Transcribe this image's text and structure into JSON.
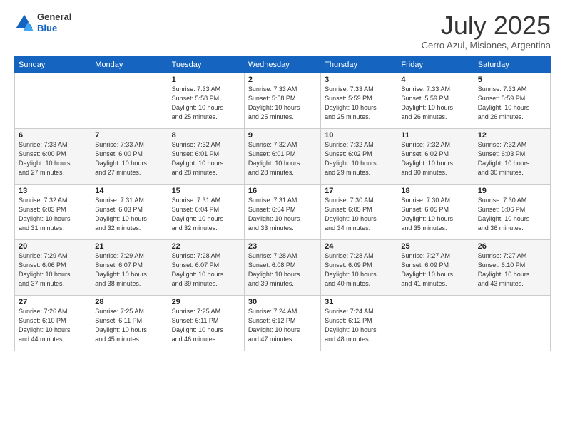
{
  "logo": {
    "general": "General",
    "blue": "Blue"
  },
  "header": {
    "title": "July 2025",
    "subtitle": "Cerro Azul, Misiones, Argentina"
  },
  "weekdays": [
    "Sunday",
    "Monday",
    "Tuesday",
    "Wednesday",
    "Thursday",
    "Friday",
    "Saturday"
  ],
  "weeks": [
    [
      {
        "day": "",
        "info": ""
      },
      {
        "day": "",
        "info": ""
      },
      {
        "day": "1",
        "info": "Sunrise: 7:33 AM\nSunset: 5:58 PM\nDaylight: 10 hours\nand 25 minutes."
      },
      {
        "day": "2",
        "info": "Sunrise: 7:33 AM\nSunset: 5:58 PM\nDaylight: 10 hours\nand 25 minutes."
      },
      {
        "day": "3",
        "info": "Sunrise: 7:33 AM\nSunset: 5:59 PM\nDaylight: 10 hours\nand 25 minutes."
      },
      {
        "day": "4",
        "info": "Sunrise: 7:33 AM\nSunset: 5:59 PM\nDaylight: 10 hours\nand 26 minutes."
      },
      {
        "day": "5",
        "info": "Sunrise: 7:33 AM\nSunset: 5:59 PM\nDaylight: 10 hours\nand 26 minutes."
      }
    ],
    [
      {
        "day": "6",
        "info": "Sunrise: 7:33 AM\nSunset: 6:00 PM\nDaylight: 10 hours\nand 27 minutes."
      },
      {
        "day": "7",
        "info": "Sunrise: 7:33 AM\nSunset: 6:00 PM\nDaylight: 10 hours\nand 27 minutes."
      },
      {
        "day": "8",
        "info": "Sunrise: 7:32 AM\nSunset: 6:01 PM\nDaylight: 10 hours\nand 28 minutes."
      },
      {
        "day": "9",
        "info": "Sunrise: 7:32 AM\nSunset: 6:01 PM\nDaylight: 10 hours\nand 28 minutes."
      },
      {
        "day": "10",
        "info": "Sunrise: 7:32 AM\nSunset: 6:02 PM\nDaylight: 10 hours\nand 29 minutes."
      },
      {
        "day": "11",
        "info": "Sunrise: 7:32 AM\nSunset: 6:02 PM\nDaylight: 10 hours\nand 30 minutes."
      },
      {
        "day": "12",
        "info": "Sunrise: 7:32 AM\nSunset: 6:03 PM\nDaylight: 10 hours\nand 30 minutes."
      }
    ],
    [
      {
        "day": "13",
        "info": "Sunrise: 7:32 AM\nSunset: 6:03 PM\nDaylight: 10 hours\nand 31 minutes."
      },
      {
        "day": "14",
        "info": "Sunrise: 7:31 AM\nSunset: 6:03 PM\nDaylight: 10 hours\nand 32 minutes."
      },
      {
        "day": "15",
        "info": "Sunrise: 7:31 AM\nSunset: 6:04 PM\nDaylight: 10 hours\nand 32 minutes."
      },
      {
        "day": "16",
        "info": "Sunrise: 7:31 AM\nSunset: 6:04 PM\nDaylight: 10 hours\nand 33 minutes."
      },
      {
        "day": "17",
        "info": "Sunrise: 7:30 AM\nSunset: 6:05 PM\nDaylight: 10 hours\nand 34 minutes."
      },
      {
        "day": "18",
        "info": "Sunrise: 7:30 AM\nSunset: 6:05 PM\nDaylight: 10 hours\nand 35 minutes."
      },
      {
        "day": "19",
        "info": "Sunrise: 7:30 AM\nSunset: 6:06 PM\nDaylight: 10 hours\nand 36 minutes."
      }
    ],
    [
      {
        "day": "20",
        "info": "Sunrise: 7:29 AM\nSunset: 6:06 PM\nDaylight: 10 hours\nand 37 minutes."
      },
      {
        "day": "21",
        "info": "Sunrise: 7:29 AM\nSunset: 6:07 PM\nDaylight: 10 hours\nand 38 minutes."
      },
      {
        "day": "22",
        "info": "Sunrise: 7:28 AM\nSunset: 6:07 PM\nDaylight: 10 hours\nand 39 minutes."
      },
      {
        "day": "23",
        "info": "Sunrise: 7:28 AM\nSunset: 6:08 PM\nDaylight: 10 hours\nand 39 minutes."
      },
      {
        "day": "24",
        "info": "Sunrise: 7:28 AM\nSunset: 6:09 PM\nDaylight: 10 hours\nand 40 minutes."
      },
      {
        "day": "25",
        "info": "Sunrise: 7:27 AM\nSunset: 6:09 PM\nDaylight: 10 hours\nand 41 minutes."
      },
      {
        "day": "26",
        "info": "Sunrise: 7:27 AM\nSunset: 6:10 PM\nDaylight: 10 hours\nand 43 minutes."
      }
    ],
    [
      {
        "day": "27",
        "info": "Sunrise: 7:26 AM\nSunset: 6:10 PM\nDaylight: 10 hours\nand 44 minutes."
      },
      {
        "day": "28",
        "info": "Sunrise: 7:25 AM\nSunset: 6:11 PM\nDaylight: 10 hours\nand 45 minutes."
      },
      {
        "day": "29",
        "info": "Sunrise: 7:25 AM\nSunset: 6:11 PM\nDaylight: 10 hours\nand 46 minutes."
      },
      {
        "day": "30",
        "info": "Sunrise: 7:24 AM\nSunset: 6:12 PM\nDaylight: 10 hours\nand 47 minutes."
      },
      {
        "day": "31",
        "info": "Sunrise: 7:24 AM\nSunset: 6:12 PM\nDaylight: 10 hours\nand 48 minutes."
      },
      {
        "day": "",
        "info": ""
      },
      {
        "day": "",
        "info": ""
      }
    ]
  ]
}
